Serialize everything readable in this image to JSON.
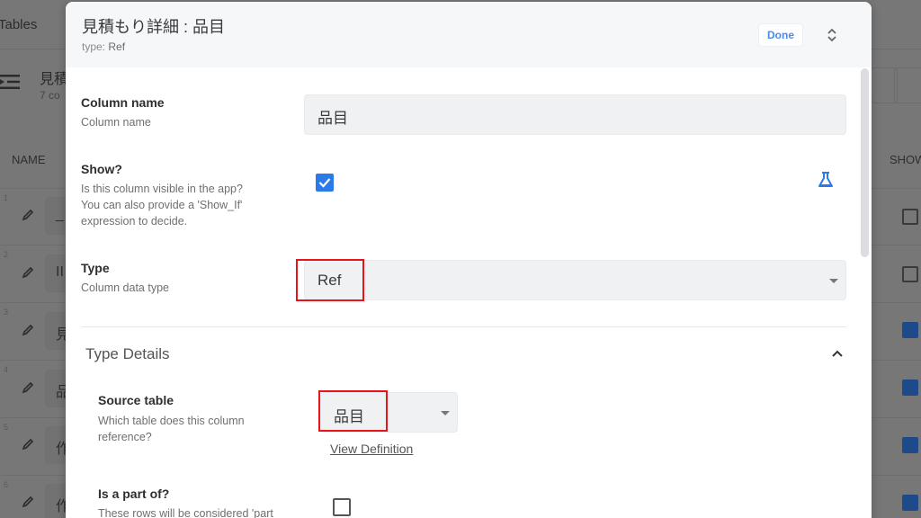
{
  "background": {
    "breadcrumb": "Tables",
    "table_title": "見積",
    "table_subtitle": "7 co",
    "columns": {
      "name": "NAME",
      "show": "SHOW"
    },
    "rows": [
      {
        "num": "1",
        "name": "_",
        "show": false
      },
      {
        "num": "2",
        "name": "II",
        "show": false
      },
      {
        "num": "3",
        "name": "見",
        "show": true
      },
      {
        "num": "4",
        "name": "品",
        "show": true
      },
      {
        "num": "5",
        "name": "作",
        "show": true
      },
      {
        "num": "6",
        "name": "作",
        "show": true
      }
    ]
  },
  "modal": {
    "title": "見積もり詳細 : 品目",
    "subtitle_prefix": "type: ",
    "subtitle_value": "Ref",
    "done_label": "Done",
    "fields": {
      "column_name": {
        "label": "Column name",
        "description": "Column name",
        "value": "品目"
      },
      "show": {
        "label": "Show?",
        "description_lines": [
          "Is this column visible in the app?",
          "You can also provide a 'Show_If'",
          "expression to decide."
        ],
        "checked": true
      },
      "type": {
        "label": "Type",
        "description": "Column data type",
        "value": "Ref"
      }
    },
    "type_details": {
      "title": "Type Details",
      "source_table": {
        "label": "Source table",
        "description_lines": [
          "Which table does this column",
          "reference?"
        ],
        "value": "品目",
        "link_label": "View Definition"
      },
      "is_part_of": {
        "label": "Is a part of?",
        "description": "These rows will be considered 'part",
        "checked": false
      }
    }
  },
  "colors": {
    "accent": "#2a7ae9",
    "done_text": "#4a8af4",
    "highlight": "#e8141b"
  }
}
